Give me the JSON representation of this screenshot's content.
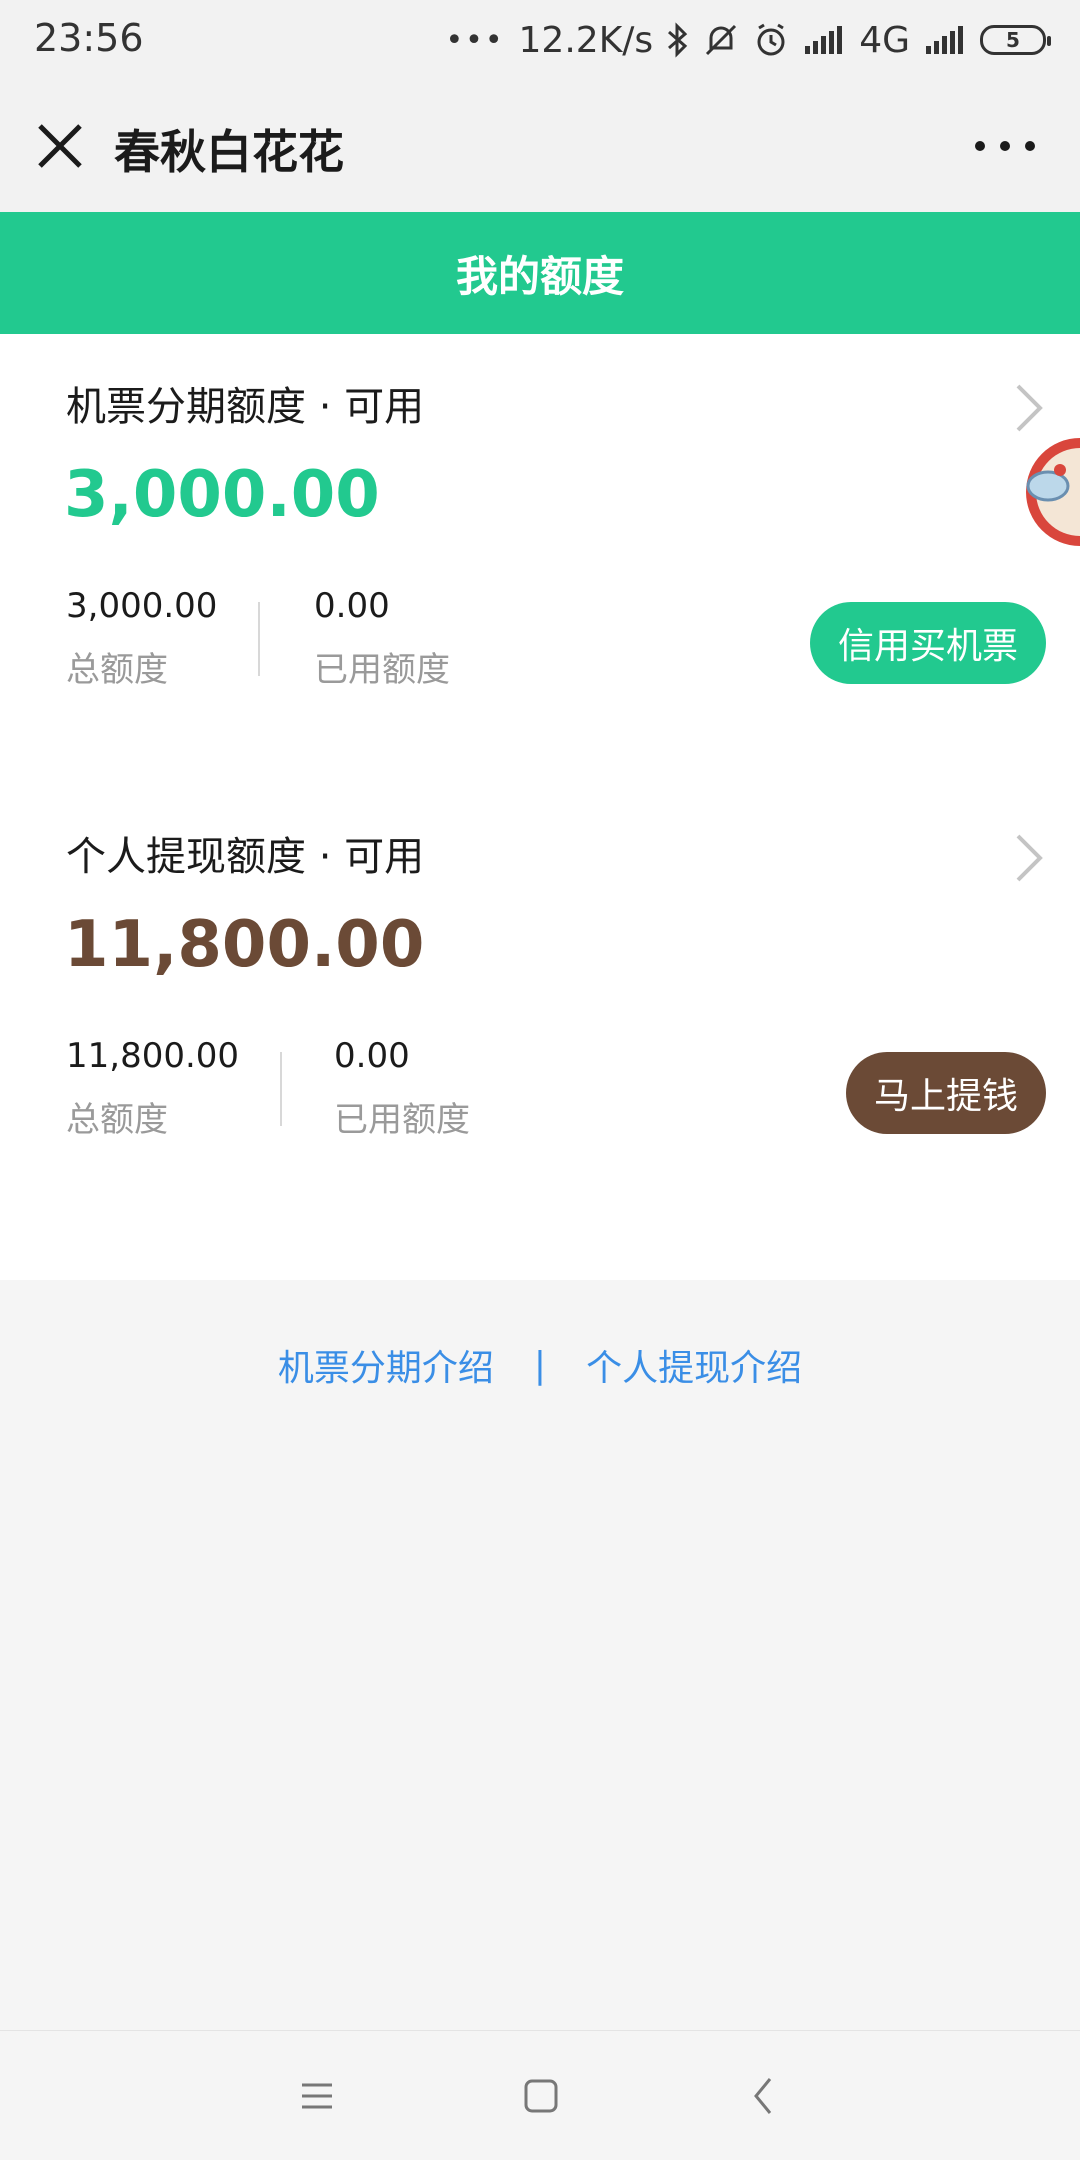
{
  "status_bar": {
    "time": "23:56",
    "network_speed": "12.2K/s",
    "network_type": "4G",
    "battery": "5"
  },
  "title_bar": {
    "title": "春秋白花花"
  },
  "header": {
    "title": "我的额度"
  },
  "cards": [
    {
      "label": "机票分期额度 · 可用",
      "amount": "3,000.00",
      "total_value": "3,000.00",
      "total_label": "总额度",
      "used_value": "0.00",
      "used_label": "已用额度",
      "button_label": "信用买机票"
    },
    {
      "label": "个人提现额度 · 可用",
      "amount": "11,800.00",
      "total_value": "11,800.00",
      "total_label": "总额度",
      "used_value": "0.00",
      "used_label": "已用额度",
      "button_label": "马上提钱"
    }
  ],
  "footer": {
    "link_1": "机票分期介绍",
    "separator": "|",
    "link_2": "个人提现介绍"
  },
  "colors": {
    "accent_green": "#22c98f",
    "accent_brown": "#6b4a36",
    "link_blue": "#3a8ee6"
  }
}
